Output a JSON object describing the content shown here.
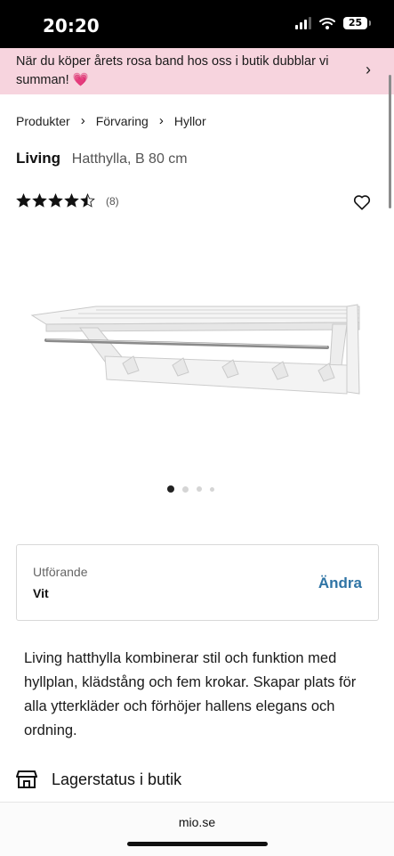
{
  "status_bar": {
    "time": "20:20",
    "battery": "25"
  },
  "promo": {
    "text": "När du köper årets rosa band hos oss i butik dubblar vi summan! 💗"
  },
  "breadcrumb": {
    "items": [
      "Produkter",
      "Förvaring",
      "Hyllor"
    ]
  },
  "product": {
    "brand": "Living",
    "subtitle": "Hatthylla, B 80 cm",
    "rating": 4.5,
    "rating_count": "(8)",
    "image_count": 4,
    "active_image": 1
  },
  "variant": {
    "label": "Utförande",
    "value": "Vit",
    "change_label": "Ändra"
  },
  "description": "Living hatthylla kombinerar stil och funktion med hyllplan, klädstång och fem krokar. Skapar plats för alla ytterkläder och förhöjer hallens elegans och ordning.",
  "stock": {
    "label": "Lagerstatus i butik"
  },
  "browser": {
    "url": "mio.se"
  },
  "colors": {
    "promo_bg": "#f7d4de",
    "accent": "#2f74a5"
  }
}
